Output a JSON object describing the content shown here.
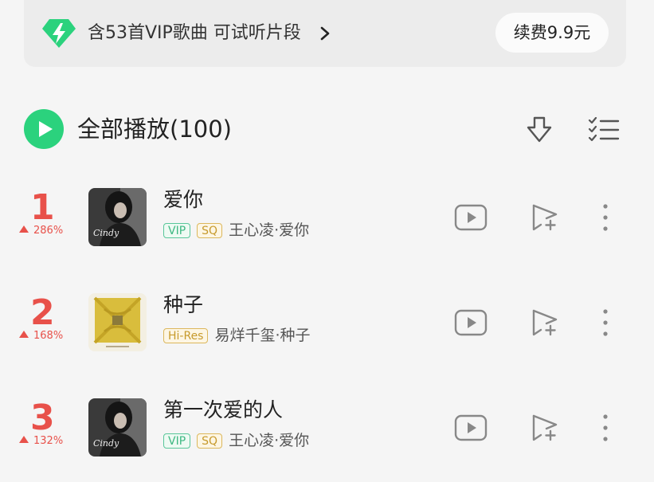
{
  "banner": {
    "text": "含53首VIP歌曲 可试听片段",
    "renew_label": "续费9.9元"
  },
  "playlist": {
    "play_all_label": "全部播放(100)"
  },
  "colors": {
    "accent_green": "#2bd27d",
    "rank_red": "#e8514a",
    "vip_green": "#59c79a",
    "quality_gold": "#dcb75b"
  },
  "songs": [
    {
      "rank": "1",
      "trend": "286%",
      "title": "爱你",
      "badges": [
        "VIP",
        "SQ"
      ],
      "artist_album": "王心凌·爱你"
    },
    {
      "rank": "2",
      "trend": "168%",
      "title": "种子",
      "badges": [
        "Hi-Res"
      ],
      "artist_album": "易烊千玺·种子"
    },
    {
      "rank": "3",
      "trend": "132%",
      "title": "第一次爱的人",
      "badges": [
        "VIP",
        "SQ"
      ],
      "artist_album": "王心凌·爱你"
    }
  ],
  "icons": {
    "banner": "lightning-diamond-icon",
    "play_all": "play-icon",
    "download": "download-icon",
    "manage": "multi-select-list-icon",
    "row_mv": "mv-play-icon",
    "row_add": "add-to-playlist-icon",
    "row_more": "more-vertical-icon"
  }
}
